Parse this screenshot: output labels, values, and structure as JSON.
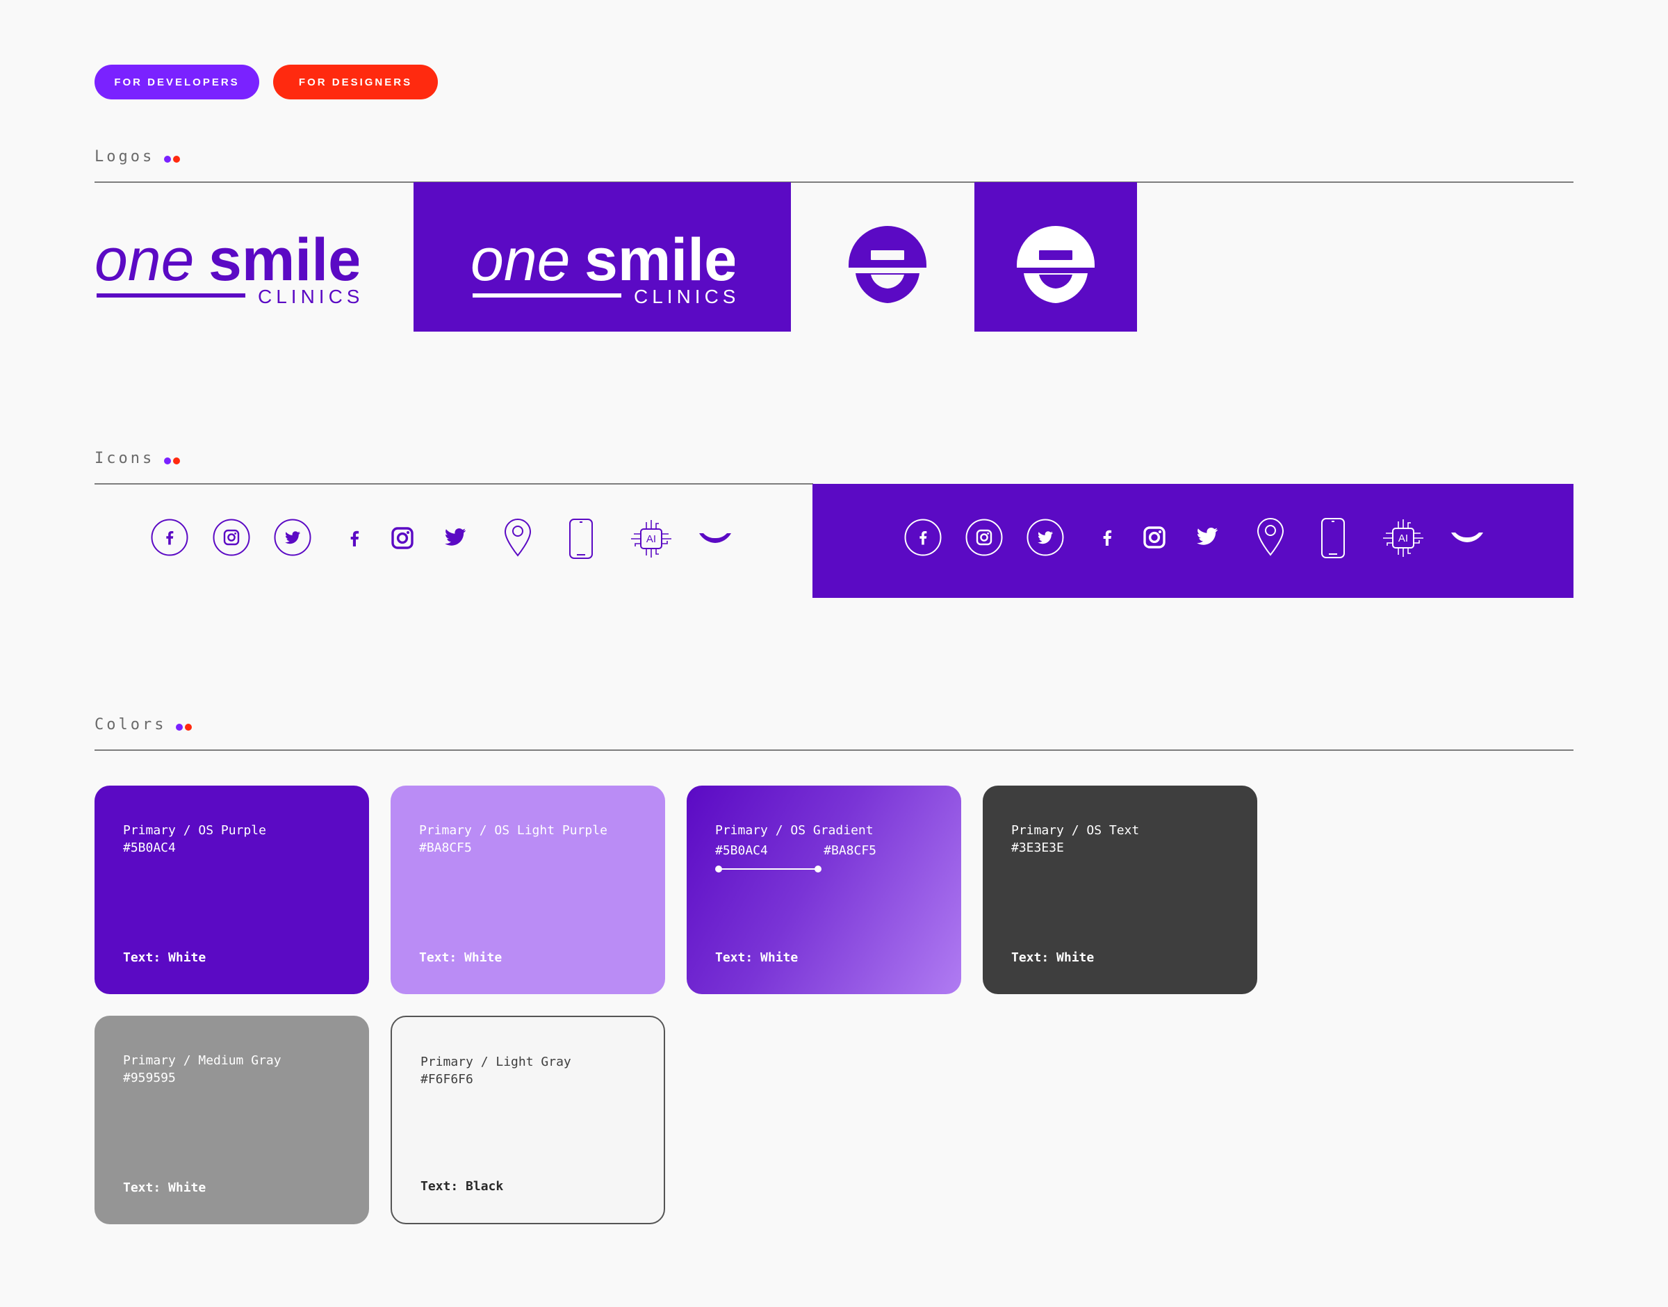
{
  "buttons": {
    "developers": "FOR DEVELOPERS",
    "designers": "FOR DESIGNERS"
  },
  "accent": {
    "purple": "#7A22FF",
    "red": "#FF2A0F",
    "brand": "#5B0AC4"
  },
  "sections": {
    "logos": "Logos",
    "icons": "Icons",
    "colors": "Colors"
  },
  "logo": {
    "word_one": "one",
    "word_smile": "smile",
    "word_clinics": "CLINICS"
  },
  "icon_set": [
    "facebook-circle-icon",
    "instagram-circle-icon",
    "twitter-circle-icon",
    "facebook-icon",
    "instagram-icon",
    "twitter-icon",
    "location-pin-icon",
    "smartphone-icon",
    "ai-chip-icon",
    "smile-icon"
  ],
  "ai_label": "AI",
  "colors": [
    {
      "name": "Primary / OS Purple",
      "hex": "#5B0AC4",
      "text": "Text: White"
    },
    {
      "name": "Primary / OS Light Purple",
      "hex": "#BA8CF5",
      "text": "Text: White"
    },
    {
      "name": "Primary / OS Gradient",
      "hex_start": "#5B0AC4",
      "hex_end": "#BA8CF5",
      "text": "Text: White"
    },
    {
      "name": "Primary / OS Text",
      "hex": "#3E3E3E",
      "text": "Text: White"
    },
    {
      "name": "Primary / Medium Gray",
      "hex": "#959595",
      "text": "Text: White"
    },
    {
      "name": "Primary / Light Gray",
      "hex": "#F6F6F6",
      "text": "Text: Black"
    }
  ]
}
